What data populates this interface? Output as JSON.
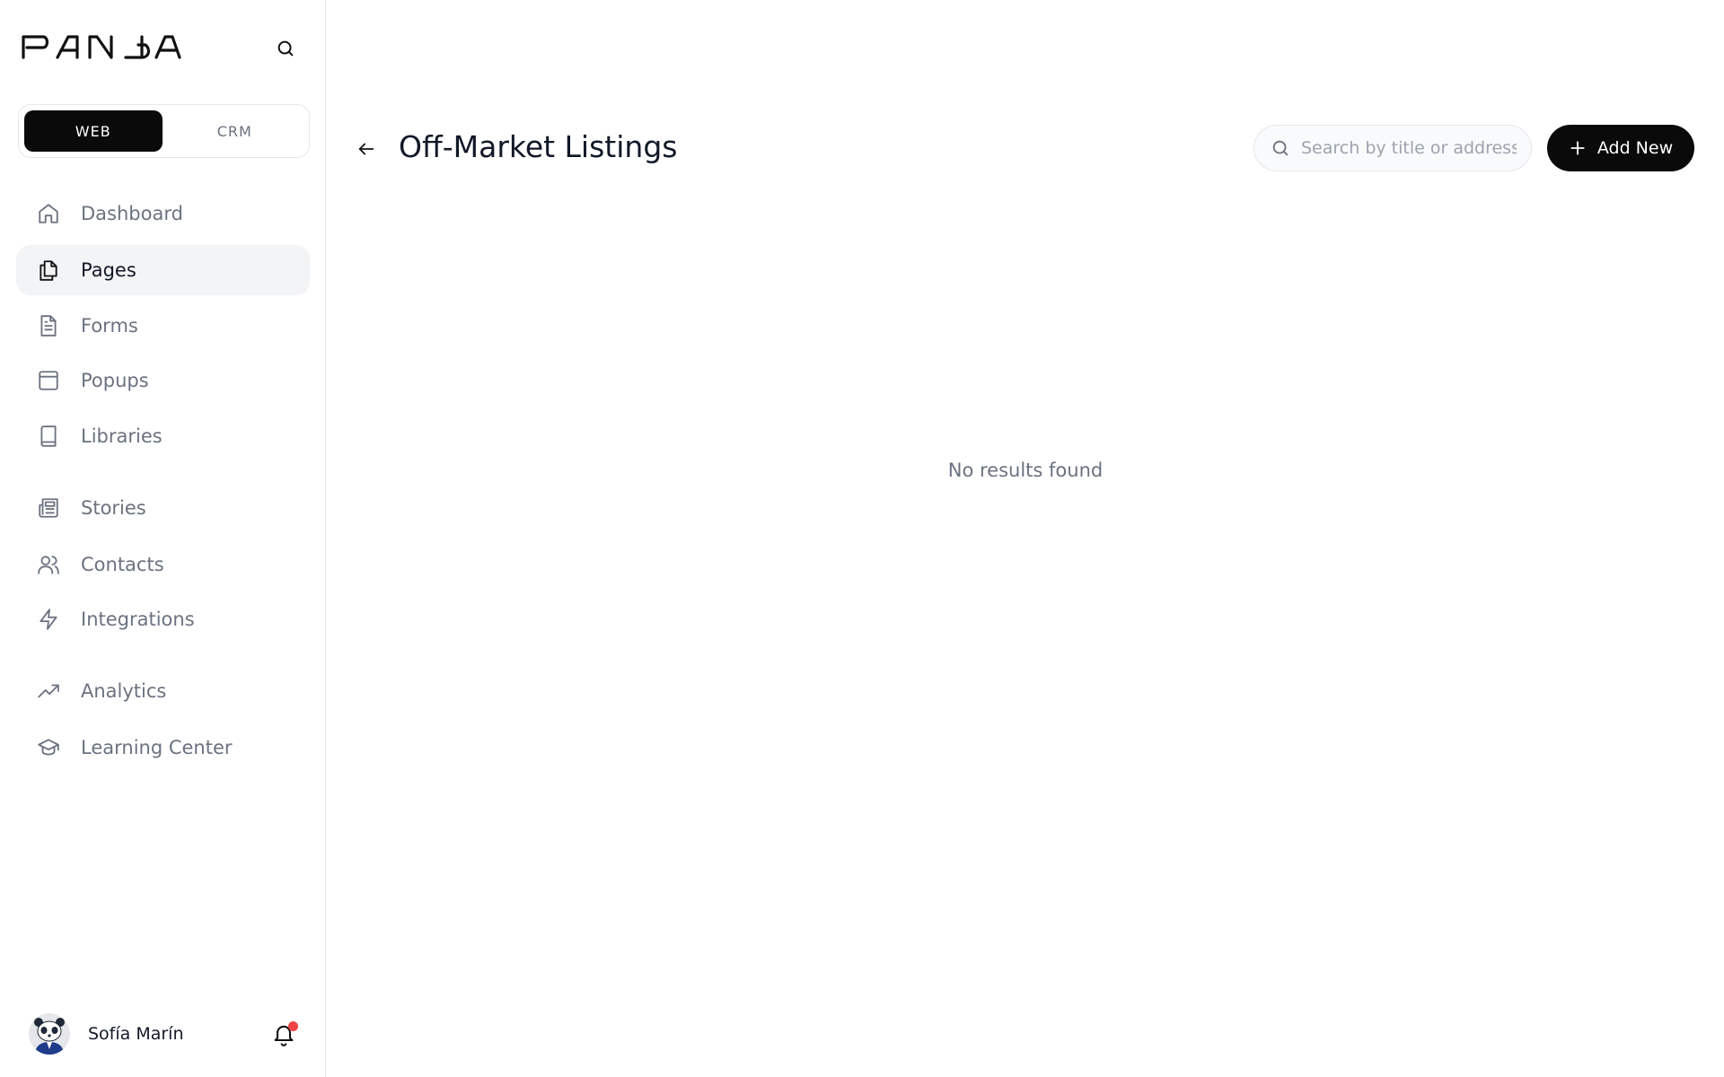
{
  "brand": {
    "logo_text": "PANDA"
  },
  "sidebar": {
    "mode_toggle": [
      {
        "label": "WEB",
        "active": true
      },
      {
        "label": "CRM",
        "active": false
      }
    ],
    "nav": [
      {
        "label": "Dashboard",
        "icon": "home-icon"
      },
      {
        "label": "Pages",
        "icon": "pages-icon",
        "active": true
      },
      {
        "label": "Forms",
        "icon": "document-icon"
      },
      {
        "label": "Popups",
        "icon": "window-icon"
      },
      {
        "label": "Libraries",
        "icon": "book-icon"
      },
      {
        "label": "Stories",
        "icon": "newspaper-icon"
      },
      {
        "label": "Contacts",
        "icon": "users-icon"
      },
      {
        "label": "Integrations",
        "icon": "lightning-icon"
      },
      {
        "label": "Analytics",
        "icon": "trend-up-icon"
      },
      {
        "label": "Learning Center",
        "icon": "graduation-cap-icon"
      }
    ],
    "user": {
      "name": "Sofía Marín",
      "has_notification": true
    }
  },
  "main": {
    "title": "Off-Market Listings",
    "search": {
      "placeholder": "Search by title or address",
      "value": ""
    },
    "add_button_label": "Add New",
    "empty_message": "No results found"
  },
  "colors": {
    "primary": "#0a0a0a",
    "active_nav_bg": "#f3f4f6",
    "notification": "#ef4444",
    "muted_text": "#6b7280"
  }
}
